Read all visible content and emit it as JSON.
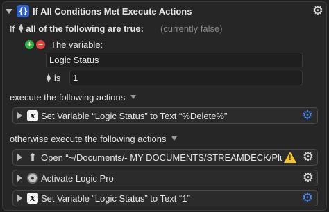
{
  "header": {
    "title": "If All Conditions Met Execute Actions"
  },
  "condition": {
    "if_label": "If",
    "match_selector": "all of the following are true:",
    "status_hint": "(currently false)",
    "variable_label": "The variable:",
    "variable_name": "Logic Status",
    "operator": "is",
    "value": "1"
  },
  "sections": {
    "execute_label": "execute the following actions",
    "otherwise_label": "otherwise execute the following actions"
  },
  "actions": {
    "then_1": "Set Variable “Logic Status” to Text “%Delete%”",
    "else_1": "Open “~/Documents/- MY DOCUMENTS/STREAMDECK/Plugi…",
    "else_2": "Activate Logic Pro",
    "else_3": "Set Variable “Logic Status” to Text “1”"
  },
  "icons": {
    "braces": "{}",
    "x": "x",
    "gear": "⚙",
    "warn": "!"
  },
  "colors": {
    "background": "#1e1e1e",
    "accent_blue": "#4a86f0",
    "add_green": "#2fb344",
    "remove_red": "#e0443a",
    "warning_yellow": "#f3c623"
  }
}
